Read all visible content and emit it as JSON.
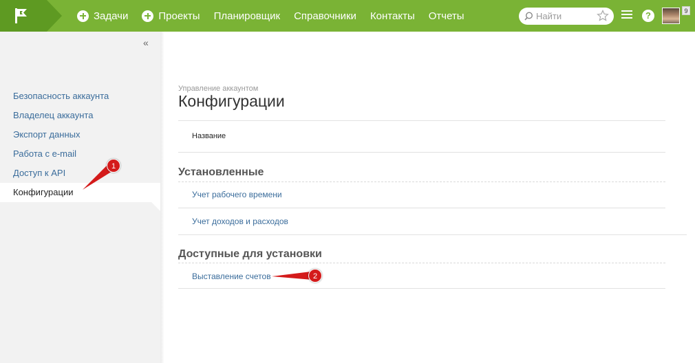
{
  "nav": {
    "items": [
      {
        "label": "Задачи",
        "icon": "plus-icon"
      },
      {
        "label": "Проекты",
        "icon": "plus-icon"
      },
      {
        "label": "Планировщик"
      },
      {
        "label": "Справочники"
      },
      {
        "label": "Контакты"
      },
      {
        "label": "Отчеты"
      }
    ],
    "search_placeholder": "Найти",
    "help_label": "?",
    "notification_count": "9"
  },
  "sidebar": {
    "collapse_label": "«",
    "items": [
      {
        "label": "Безопасность аккаунта"
      },
      {
        "label": "Владелец аккаунта"
      },
      {
        "label": "Экспорт данных"
      },
      {
        "label": "Работа с e-mail"
      },
      {
        "label": "Доступ к API"
      },
      {
        "label": "Конфигурации",
        "active": true
      }
    ]
  },
  "main": {
    "breadcrumb": "Управление аккаунтом",
    "title": "Конфигурации",
    "column_header": "Название",
    "installed": {
      "title": "Установленные",
      "items": [
        "Учет рабочего времени",
        "Учет доходов и расходов"
      ]
    },
    "available": {
      "title": "Доступные для установки",
      "items": [
        "Выставление счетов"
      ]
    }
  },
  "annotations": [
    "1",
    "2"
  ],
  "colors": {
    "topbar": "#7ab335",
    "logo": "#5e9a22",
    "link": "#3a6c9b",
    "annotation": "#d41b1b"
  }
}
